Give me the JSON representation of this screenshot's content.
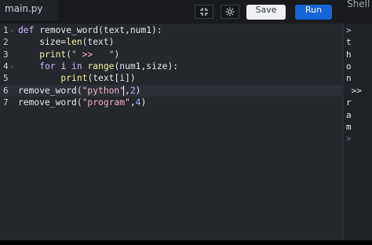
{
  "toolbar": {
    "file_tab": "main.py",
    "save_label": "Save",
    "run_label": "Run",
    "shell_tab": "Shell",
    "icons": [
      "expand-icon",
      "settings-icon"
    ]
  },
  "editor": {
    "line_numbers": [
      "1",
      "2",
      "3",
      "4",
      "5",
      "6",
      "7"
    ],
    "lines": [
      [
        {
          "t": "def ",
          "c": "kw"
        },
        {
          "t": "remove_word(text,num1):",
          "c": "plain"
        }
      ],
      [
        {
          "t": "    size=",
          "c": "plain"
        },
        {
          "t": "len",
          "c": "fn"
        },
        {
          "t": "(text)",
          "c": "plain"
        }
      ],
      [
        {
          "t": "    ",
          "c": "plain"
        },
        {
          "t": "print",
          "c": "fn"
        },
        {
          "t": "(",
          "c": "plain"
        },
        {
          "t": "\" >>   \"",
          "c": "str"
        },
        {
          "t": ")",
          "c": "plain"
        }
      ],
      [
        {
          "t": "    ",
          "c": "plain"
        },
        {
          "t": "for ",
          "c": "kw"
        },
        {
          "t": "i ",
          "c": "plain"
        },
        {
          "t": "in ",
          "c": "kw"
        },
        {
          "t": "range",
          "c": "fn"
        },
        {
          "t": "(num1,size):",
          "c": "plain"
        }
      ],
      [
        {
          "t": "        ",
          "c": "plain"
        },
        {
          "t": "print",
          "c": "fn"
        },
        {
          "t": "(text[i])",
          "c": "plain"
        }
      ],
      [
        {
          "t": "remove_word(",
          "c": "plain"
        },
        {
          "t": "\"python\"",
          "c": "str"
        },
        {
          "t": ",",
          "c": "plain"
        },
        {
          "t": "2",
          "c": "num"
        },
        {
          "t": ")",
          "c": "plain"
        }
      ],
      [
        {
          "t": "remove_word(",
          "c": "plain"
        },
        {
          "t": "\"program\"",
          "c": "str"
        },
        {
          "t": ",",
          "c": "plain"
        },
        {
          "t": "4",
          "c": "num"
        },
        {
          "t": ")",
          "c": "plain"
        }
      ]
    ],
    "active_line": "6"
  },
  "console": {
    "lines": [
      ">",
      "t",
      "h",
      "o",
      "n",
      " >>",
      "r",
      "a",
      "m",
      ">"
    ]
  },
  "colors": {
    "run_button": "#1565d8",
    "editor_bg": "#24272c",
    "keyword": "#d3b8ff",
    "builtin": "#f5f0a8",
    "string": "#f2b3c7",
    "number": "#a9b4ff"
  }
}
